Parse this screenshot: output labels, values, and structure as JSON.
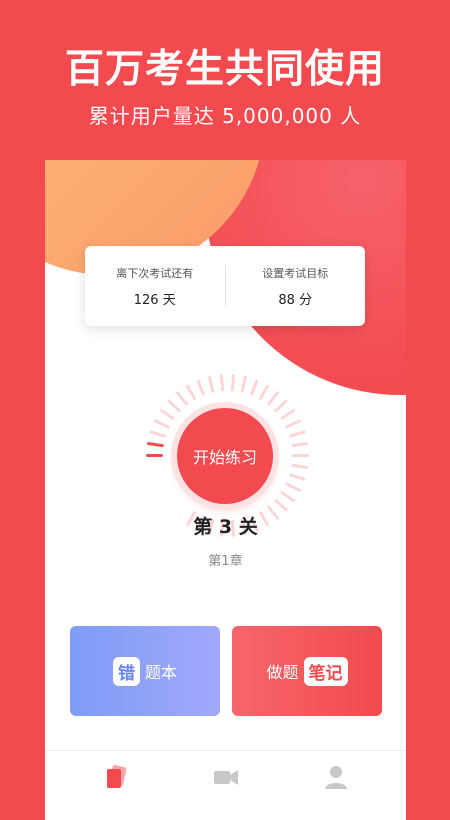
{
  "promo": {
    "title": "百万考生共同使用",
    "subtitle": "累计用户量达 5,000,000 人"
  },
  "info_card": {
    "countdown_label": "离下次考试还有",
    "countdown_value": "126 天",
    "target_label": "设置考试目标",
    "target_value": "88 分"
  },
  "practice": {
    "button_label": "开始练习",
    "level": "第 3 关",
    "chapter": "第1章",
    "progress_fraction": 0.05
  },
  "cards": {
    "wrong_tag": "错",
    "wrong_text": "题本",
    "notes_text": "做题",
    "notes_tag": "笔记"
  },
  "tabbar": {
    "icons": [
      "cards-icon",
      "video-icon",
      "user-icon"
    ],
    "active": 0
  },
  "colors": {
    "brand_red": "#f24a4f",
    "orange": "#fa9b6a",
    "blue": "#7e9cf7",
    "tick_light": "#fbd6d7",
    "inactive_icon": "#c8c8c8"
  }
}
